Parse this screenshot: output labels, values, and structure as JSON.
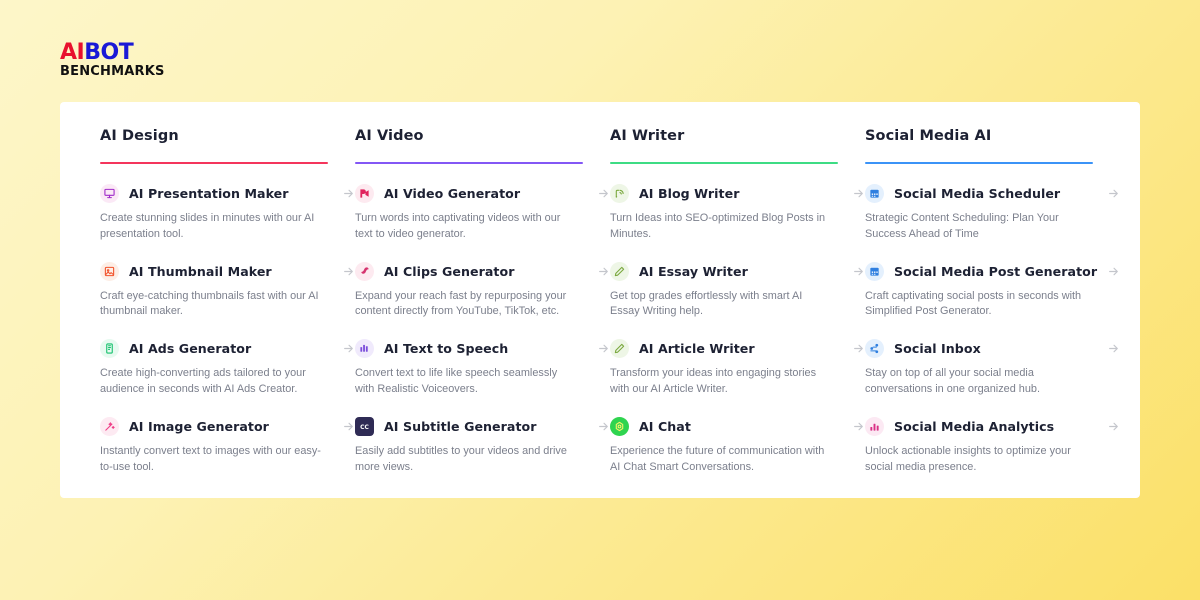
{
  "logo": {
    "part1": "AI",
    "part2": "BOT",
    "part3": "BENCHMARKS"
  },
  "columns": [
    {
      "title": "AI Design",
      "rule_color": "#f4355c",
      "items": [
        {
          "title": "AI Presentation Maker",
          "desc": "Create stunning slides in minutes with our AI presentation tool.",
          "icon": "presentation-icon",
          "icon_bg": "#fbe9f6",
          "icon_color": "#a02bc9",
          "arrow": "arrow-right-icon"
        },
        {
          "title": "AI Thumbnail Maker",
          "desc": "Craft eye-catching thumbnails fast with our AI thumbnail maker.",
          "icon": "thumbnail-image-icon",
          "icon_bg": "#fdeee6",
          "icon_color": "#f2542d",
          "arrow": "arrow-right-icon"
        },
        {
          "title": "AI Ads Generator",
          "desc": "Create high-converting ads tailored to your audience in seconds with AI Ads Creator.",
          "icon": "ads-mobile-icon",
          "icon_bg": "#e7faf0",
          "icon_color": "#14c06b",
          "arrow": "arrow-right-icon"
        },
        {
          "title": "AI Image Generator",
          "desc": "Instantly convert text to images with our easy-to-use tool.",
          "icon": "magic-wand-icon",
          "icon_bg": "#fdeaf2",
          "icon_color": "#ef3f88",
          "arrow": "arrow-right-icon"
        }
      ]
    },
    {
      "title": "AI Video",
      "rule_color": "#8357f5",
      "items": [
        {
          "title": "AI Video Generator",
          "desc": "Turn words into captivating videos with our text to video generator.",
          "icon": "video-generator-icon",
          "icon_bg": "#fdeaf0",
          "icon_color": "#e0245e",
          "arrow": "arrow-right-icon"
        },
        {
          "title": "AI Clips Generator",
          "desc": "Expand your reach fast by repurposing your content directly from YouTube, TikTok, etc.",
          "icon": "clips-scissor-icon",
          "icon_bg": "#fdeaf0",
          "icon_color": "#d5336e",
          "arrow": "arrow-right-icon"
        },
        {
          "title": "AI Text to Speech",
          "desc": "Convert text to life like speech seamlessly with Realistic Voiceovers.",
          "icon": "text-to-speech-icon",
          "icon_bg": "#f0eafc",
          "icon_color": "#7b4ddb",
          "arrow": "arrow-right-icon"
        },
        {
          "title": "AI Subtitle Generator",
          "desc": "Easily add subtitles to your videos and drive more views.",
          "icon": "closed-caption-icon",
          "icon_bg": "#2f2b55",
          "icon_color": "#ffffff",
          "arrow": "arrow-right-icon"
        }
      ]
    },
    {
      "title": "AI Writer",
      "rule_color": "#3ddc84",
      "items": [
        {
          "title": "AI Blog Writer",
          "desc": "Turn Ideas into SEO-optimized Blog Posts in Minutes.",
          "icon": "blog-rss-icon",
          "icon_bg": "#eef6e6",
          "icon_color": "#7aa83e",
          "arrow": "arrow-right-icon"
        },
        {
          "title": "AI Essay Writer",
          "desc": "Get top grades effortlessly with smart AI Essay Writing help.",
          "icon": "pencil-icon",
          "icon_bg": "#eef6e6",
          "icon_color": "#7aa83e",
          "arrow": "arrow-right-icon"
        },
        {
          "title": "AI Article Writer",
          "desc": "Transform your ideas into engaging stories with our AI Article Writer.",
          "icon": "pencil-icon",
          "icon_bg": "#eef6e6",
          "icon_color": "#7aa83e",
          "arrow": "arrow-right-icon"
        },
        {
          "title": "AI Chat",
          "desc": "Experience the future of communication with AI Chat Smart Conversations.",
          "icon": "chat-hexagon-icon",
          "icon_bg": "#2fd44f",
          "icon_color": "#f7f36a",
          "arrow": "arrow-right-icon"
        }
      ]
    },
    {
      "title": "Social Media AI",
      "rule_color": "#3b93f7",
      "items": [
        {
          "title": "Social Media Scheduler",
          "desc": "Strategic Content Scheduling: Plan Your Success Ahead of Time",
          "icon": "calendar-icon",
          "icon_bg": "#e4f0fd",
          "icon_color": "#2f7fe0",
          "arrow": "arrow-right-icon"
        },
        {
          "title": "Social Media Post Generator",
          "desc": "Craft captivating social posts in seconds with Simplified Post Generator.",
          "icon": "calendar-icon",
          "icon_bg": "#e4f0fd",
          "icon_color": "#2f7fe0",
          "arrow": "arrow-right-icon"
        },
        {
          "title": "Social Inbox",
          "desc": "Stay on top of all your social media conversations in one organized hub.",
          "icon": "inbox-share-icon",
          "icon_bg": "#e4f0fd",
          "icon_color": "#2f7fe0",
          "arrow": "arrow-right-icon"
        },
        {
          "title": "Social Media Analytics",
          "desc": "Unlock actionable insights to optimize your social media presence.",
          "icon": "bar-chart-icon",
          "icon_bg": "#fce9f3",
          "icon_color": "#d92f86",
          "arrow": "arrow-right-icon"
        }
      ]
    }
  ]
}
